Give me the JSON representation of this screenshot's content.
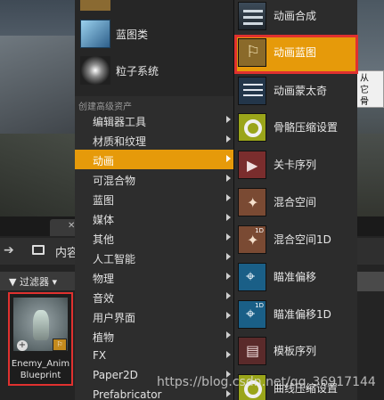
{
  "tooltip": {
    "lines": [
      "从",
      "它",
      "骨"
    ]
  },
  "content_browser": {
    "path_label": "内容",
    "filter_label": "过滤器",
    "asset": {
      "name_line1": "Enemy_Anim",
      "name_line2": "Blueprint"
    }
  },
  "left_menu": {
    "top_items": [
      {
        "label": "蓝图类",
        "icon": "book-icon"
      },
      {
        "label": "粒子系统",
        "icon": "particle-icon"
      }
    ],
    "section_title": "创建高级资产",
    "items": [
      {
        "label": "编辑器工具"
      },
      {
        "label": "材质和纹理"
      },
      {
        "label": "动画"
      },
      {
        "label": "可混合物"
      },
      {
        "label": "蓝图"
      },
      {
        "label": "媒体"
      },
      {
        "label": "其他"
      },
      {
        "label": "人工智能"
      },
      {
        "label": "物理"
      },
      {
        "label": "音效"
      },
      {
        "label": "用户界面"
      },
      {
        "label": "植物"
      },
      {
        "label": "FX"
      },
      {
        "label": "Paper2D"
      },
      {
        "label": "Prefabricator"
      }
    ],
    "highlighted": "动画"
  },
  "right_menu": {
    "items": [
      {
        "label": "动画合成",
        "icon": "anim-composite-icon"
      },
      {
        "label": "动画蓝图",
        "icon": "anim-blueprint-icon"
      },
      {
        "label": "动画蒙太奇",
        "icon": "anim-montage-icon"
      },
      {
        "label": "骨骼压缩设置",
        "icon": "bone-compression-icon"
      },
      {
        "label": "关卡序列",
        "icon": "level-sequence-icon"
      },
      {
        "label": "混合空间",
        "icon": "blend-space-icon"
      },
      {
        "label": "混合空间1D",
        "icon": "blend-space-1d-icon"
      },
      {
        "label": "瞄准偏移",
        "icon": "aim-offset-icon"
      },
      {
        "label": "瞄准偏移1D",
        "icon": "aim-offset-1d-icon"
      },
      {
        "label": "模板序列",
        "icon": "template-sequence-icon"
      },
      {
        "label": "曲线压缩设置",
        "icon": "curve-compression-icon"
      }
    ],
    "selected": "动画蓝图"
  },
  "watermark": "https://blog.csdn.net/qq_36917144",
  "colors": {
    "highlight": "#e69a0a",
    "selection_border": "#e0312f"
  }
}
